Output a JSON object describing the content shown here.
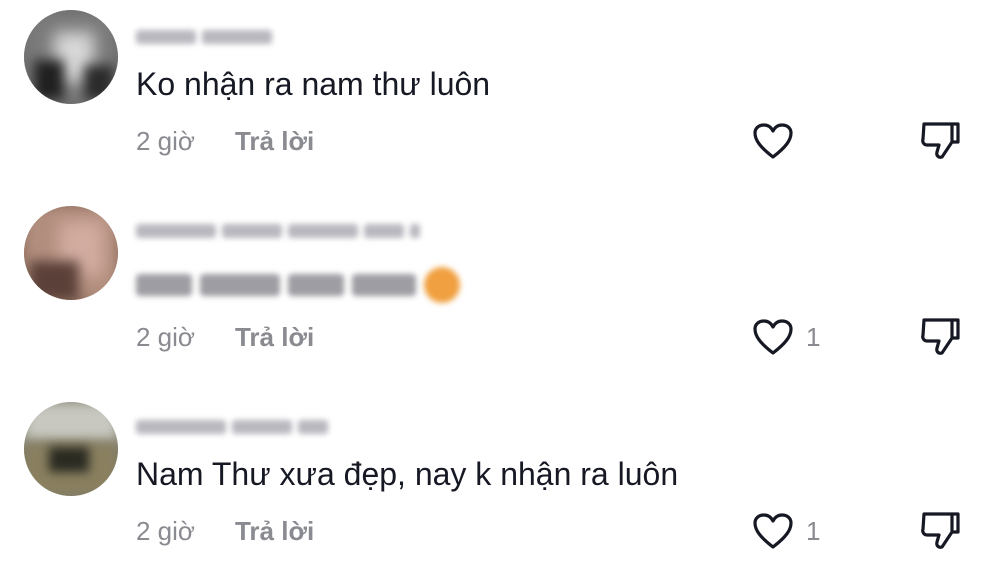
{
  "comments": [
    {
      "username": "",
      "text": "Ko nhận ra nam thư luôn",
      "time": "2 giờ",
      "reply_label": "Trả lời",
      "like_count": ""
    },
    {
      "username": "",
      "text": "",
      "time": "2 giờ",
      "reply_label": "Trả lời",
      "like_count": "1"
    },
    {
      "username": "",
      "text": "Nam Thư xưa đẹp, nay k nhận ra luôn",
      "time": "2 giờ",
      "reply_label": "Trả lời",
      "like_count": "1"
    }
  ],
  "icons": {
    "like": "heart-icon",
    "dislike": "thumbs-down-icon"
  },
  "colors": {
    "text": "#161823",
    "secondary": "#8a8b91",
    "icon": "#161823"
  }
}
